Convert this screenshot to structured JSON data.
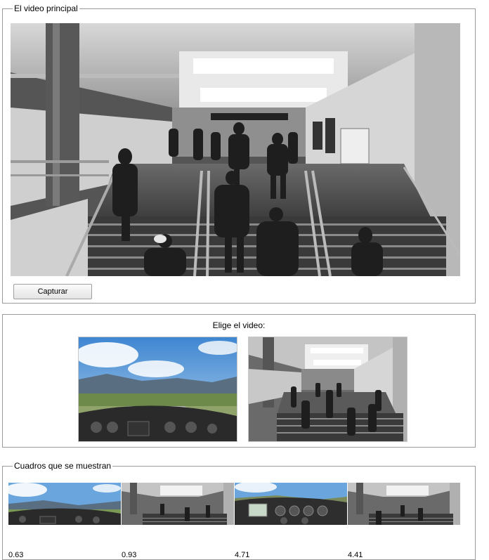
{
  "main_section": {
    "legend": "El video principal",
    "capture_label": "Capturar"
  },
  "choose_section": {
    "title": "Elige el video:",
    "videos": [
      {
        "icon": "cockpit-landing-video-thumbnail"
      },
      {
        "icon": "subway-station-video-thumbnail"
      }
    ]
  },
  "frames_section": {
    "legend": "Cuadros que se muestran",
    "frames": [
      {
        "time": "0.63",
        "icon": "cockpit-frame"
      },
      {
        "time": "0.93",
        "icon": "subway-frame"
      },
      {
        "time": "4.71",
        "icon": "cockpit-instruments-frame"
      },
      {
        "time": "4.41",
        "icon": "subway-frame"
      }
    ]
  },
  "colors": {
    "border": "#9a9a9a",
    "sky": "#5a9ad6",
    "button_top": "#fbfbfb",
    "button_bottom": "#e4e4e4"
  }
}
